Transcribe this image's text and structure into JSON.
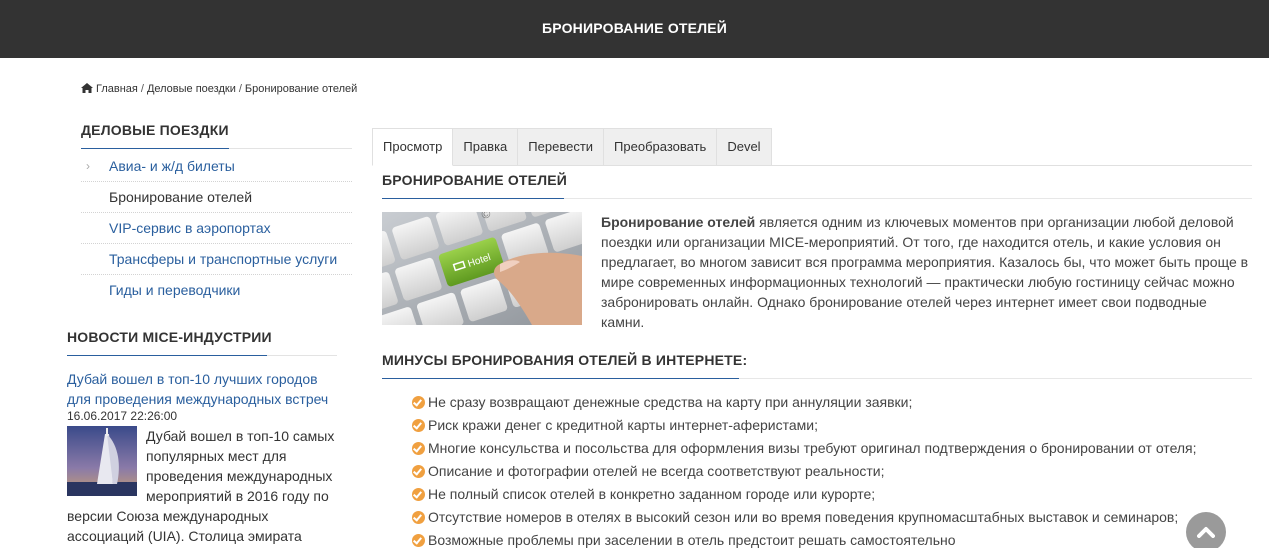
{
  "header": {
    "title": "БРОНИРОВАНИЕ ОТЕЛЕЙ"
  },
  "breadcrumb": {
    "home_icon": "home-icon",
    "items": [
      "Главная",
      "Деловые поездки",
      "Бронирование отелей"
    ],
    "separator": "/"
  },
  "sidebar": {
    "title": "ДЕЛОВЫЕ ПОЕЗДКИ",
    "items": [
      {
        "label": "Авиа- и ж/д билеты",
        "icon": "chevron-right-icon"
      },
      {
        "label": "Бронирование отелей"
      },
      {
        "label": "VIP-сервис в аэропортах"
      },
      {
        "label": "Трансферы и транспортные услуги"
      },
      {
        "label": "Гиды и переводчики"
      }
    ]
  },
  "news": {
    "title": "НОВОСТИ MICE-ИНДУСТРИИ",
    "link": "Дубай вошел в топ-10 лучших городов для проведения международных встреч",
    "date": "16.06.2017 22:26:00",
    "text_part1": "Дубай вошел в топ-10 самых популярных мест для проведения международных мероприятий в 2016 году по",
    "text_part2": "версии Союза международных ассоциаций (UIA). Столица эмирата"
  },
  "tabs": [
    {
      "label": "Просмотр",
      "active": true
    },
    {
      "label": "Правка"
    },
    {
      "label": "Перевести"
    },
    {
      "label": "Преобразовать"
    },
    {
      "label": "Devel"
    }
  ],
  "content": {
    "title": "БРОНИРОВАНИЕ ОТЕЛЕЙ",
    "hotel_key_label": "Hotel",
    "intro_bold": "Бронирование отелей",
    "intro_rest": " является одним из ключевых моментов при организации любой деловой поездки или организации MICE-мероприятий. От того, где находится отель, и какие условия он предлагает, во многом зависит вся программа мероприятия. Казалось бы, что может быть проще в мире современных информационных технологий — практически любую гостиницу сейчас можно забронировать онлайн. Однако бронирование отелей через интернет имеет свои подводные камни.",
    "minus_title": "МИНУСЫ БРОНИРОВАНИЯ ОТЕЛЕЙ В ИНТЕРНЕТЕ:",
    "minus_items": [
      "Не сразу возвращают денежные средства на карту при аннуляции заявки;",
      "Риск кражи денег с кредитной карты интернет-аферистами;",
      "Многие консульства и посольства для оформления визы требуют оригинал подтверждения о бронировании от отеля;",
      "Описание и фотографии отелей не всегда соответствуют реальности;",
      "Не полный список отелей в конкретно заданном городе или курорте;",
      "Отсутствие номеров в отелях в высокий сезон или во время поведения крупномасштабных выставок и семинаров;",
      "Возможные проблемы при заселении в отель предстоит решать самостоятельно"
    ]
  },
  "colors": {
    "topbar": "#333333",
    "link": "#2a5f9e",
    "bullet": "#f0a040",
    "key_green": "#7ab32e"
  },
  "scroll_top": {
    "icon": "chevron-up-icon"
  }
}
